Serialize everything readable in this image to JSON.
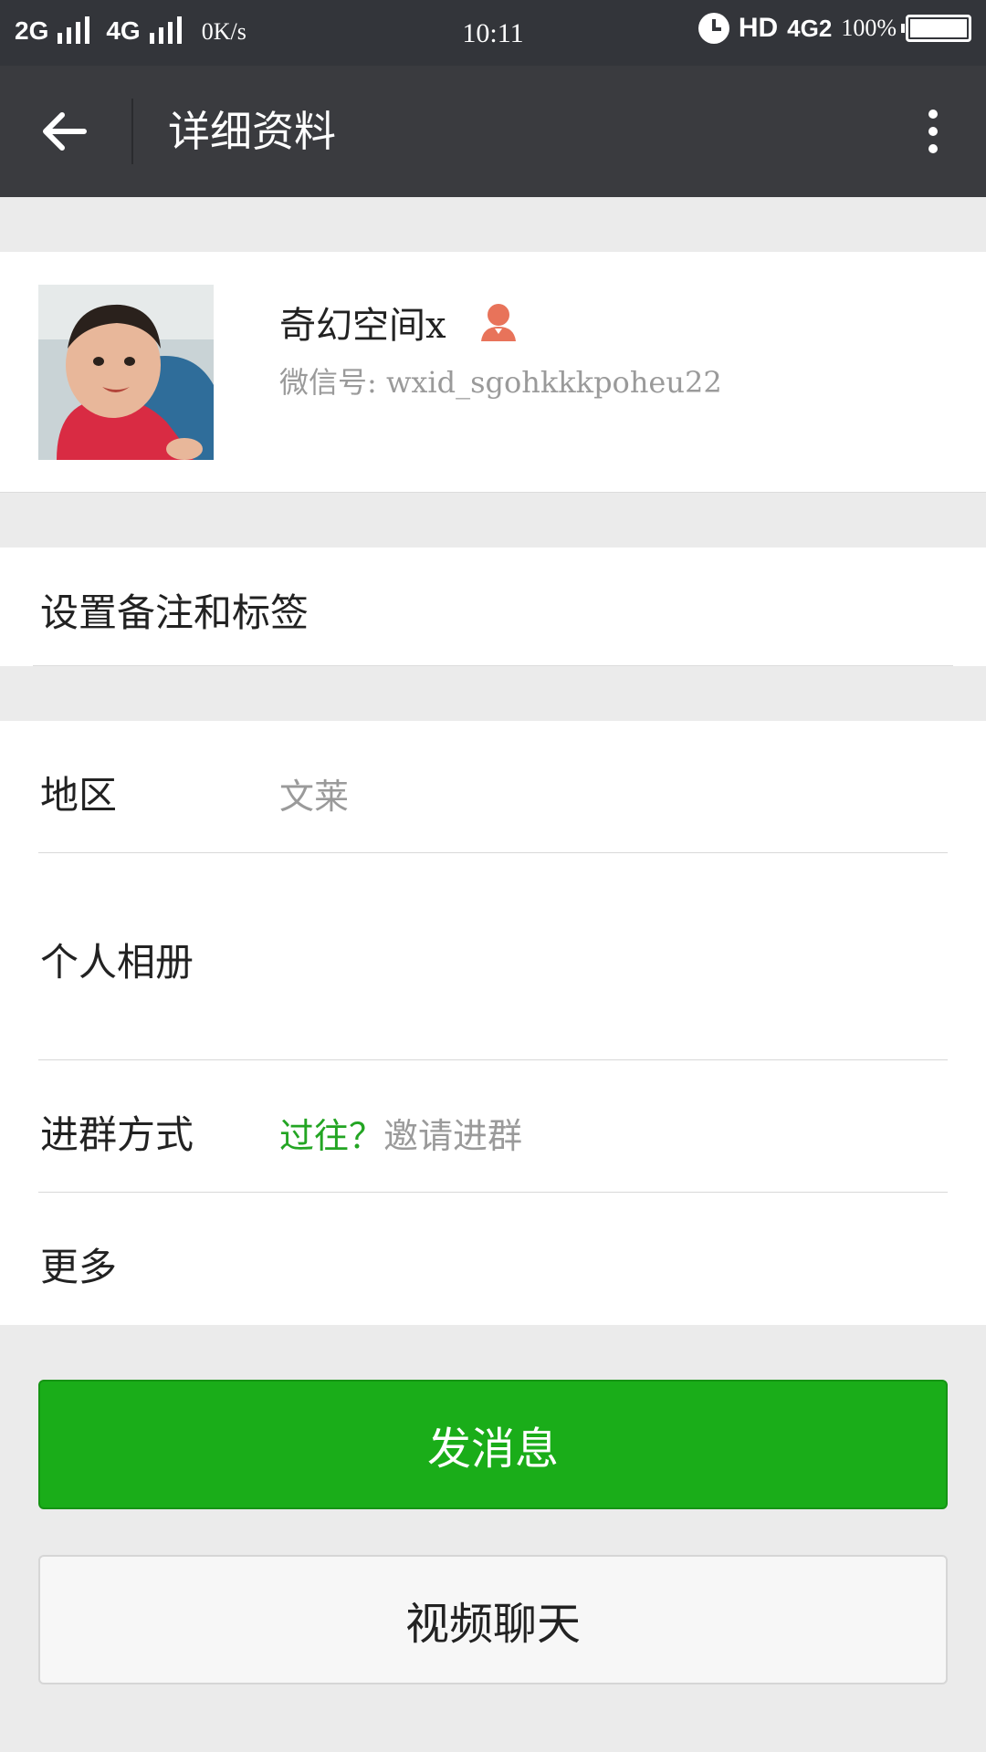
{
  "status_bar": {
    "net1": "2G",
    "net2": "4G",
    "speed": "0K/s",
    "time": "10:11",
    "hd": "HD",
    "net3": "4G2",
    "battery": "100%"
  },
  "header": {
    "title": "详细资料"
  },
  "profile": {
    "nickname": "奇幻空间x",
    "wxid": "微信号: wxid_sgohkkkpoheu22"
  },
  "remark": {
    "label": "设置备注和标签"
  },
  "info": {
    "region_label": "地区",
    "region_value": "文莱",
    "album_label": "个人相册",
    "join_label": "进群方式",
    "join_value_green": "过往？",
    "join_value": "邀请进群",
    "more_label": "更多"
  },
  "actions": {
    "message": "发消息",
    "video": "视频聊天"
  },
  "colors": {
    "accent": "#1aad19",
    "topbar": "#3a3b3f",
    "female_icon": "#e8735a"
  }
}
